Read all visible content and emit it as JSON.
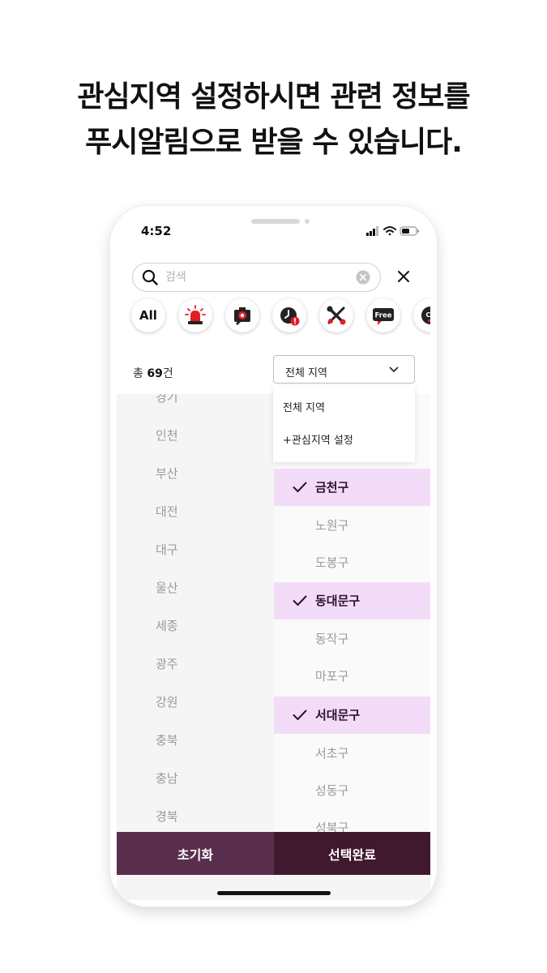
{
  "headline": {
    "line1": "관심지역 설정하시면 관련 정보를",
    "line2": "푸시알림으로 받을 수 있습니다."
  },
  "status_bar": {
    "time": "4:52"
  },
  "search": {
    "placeholder": "검색",
    "value": ""
  },
  "categories": [
    {
      "label": "All",
      "icon": "all-text"
    },
    {
      "label": "",
      "icon": "siren-icon"
    },
    {
      "label": "",
      "icon": "camera-icon"
    },
    {
      "label": "",
      "icon": "clock-alert-icon"
    },
    {
      "label": "",
      "icon": "wrench-screwdriver-icon"
    },
    {
      "label": "Free",
      "icon": "free-chat-icon"
    },
    {
      "label": "Ca",
      "icon": "cafe-icon"
    }
  ],
  "count": {
    "prefix": "총 ",
    "number": "69",
    "suffix": "건"
  },
  "region_select": {
    "selected": "전체 지역"
  },
  "dropdown": {
    "options": [
      "전체 지역",
      "+관심지역 설정"
    ]
  },
  "provinces": [
    "경기",
    "인천",
    "부산",
    "대전",
    "대구",
    "울산",
    "세종",
    "광주",
    "강원",
    "충북",
    "충남",
    "경북"
  ],
  "districts": [
    {
      "name": "금천구",
      "selected": true
    },
    {
      "name": "노원구",
      "selected": false
    },
    {
      "name": "도봉구",
      "selected": false
    },
    {
      "name": "동대문구",
      "selected": true
    },
    {
      "name": "동작구",
      "selected": false
    },
    {
      "name": "마포구",
      "selected": false
    },
    {
      "name": "서대문구",
      "selected": true
    },
    {
      "name": "서초구",
      "selected": false
    },
    {
      "name": "성동구",
      "selected": false
    },
    {
      "name": "성북구",
      "selected": false
    }
  ],
  "buttons": {
    "reset": "초기화",
    "done": "선택완료"
  },
  "colors": {
    "accent_dark": "#41192f",
    "accent": "#5a2e4d",
    "selected_bg": "#f3dcf8"
  }
}
